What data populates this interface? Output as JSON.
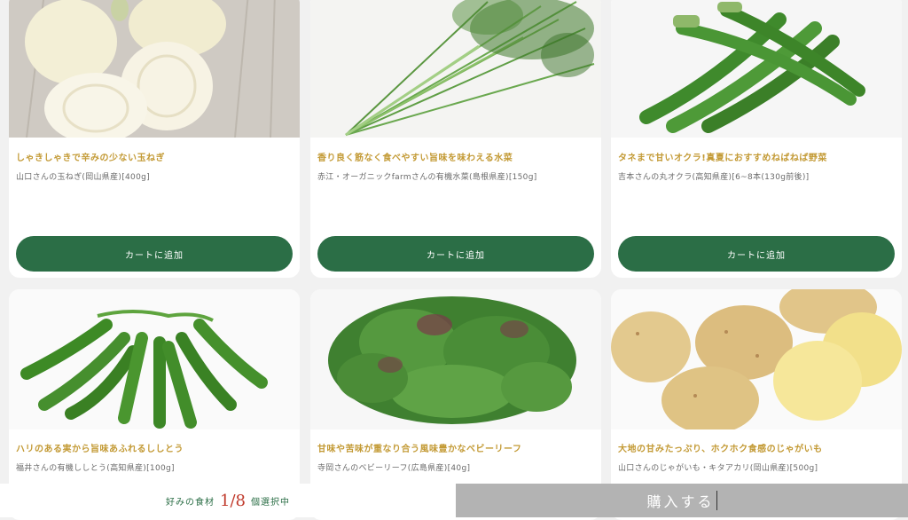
{
  "products": [
    {
      "title": "しゃきしゃきで辛みの少ない玉ねぎ",
      "detail": "山口さんの玉ねぎ(岡山県産)[400g]",
      "button": "カートに追加",
      "image_icon": "onion-image"
    },
    {
      "title": "香り良く筋なく食べやすい旨味を味わえる水菜",
      "detail": "赤江・オーガニックfarmさんの有機水菜(島根県産)[150g]",
      "button": "カートに追加",
      "image_icon": "mizuna-image"
    },
    {
      "title": "タネまで甘いオクラ!真夏におすすめねばねば野菜",
      "detail": "吉本さんの丸オクラ(高知県産)[6~8本(130g前後)]",
      "button": "カートに追加",
      "image_icon": "okra-image"
    },
    {
      "title": "ハリのある実から旨味あふれるししとう",
      "detail": "福井さんの有機ししとう(高知県産)[100g]",
      "image_icon": "shishito-image"
    },
    {
      "title": "甘味や苦味が重なり合う風味豊かなベビーリーフ",
      "detail": "寺岡さんのベビーリーフ(広島県産)[40g]",
      "image_icon": "baby-leaf-image"
    },
    {
      "title": "大地の甘みたっぷり、ホクホク食感のじゃがいも",
      "detail": "山口さんのじゃがいも・キタアカリ(岡山県産)[500g]",
      "image_icon": "potato-image"
    }
  ],
  "footer": {
    "label": "好みの食材",
    "count": "1/8",
    "suffix": "個選択中",
    "buy_button": "購入する"
  },
  "colors": {
    "accent": "#2b6e46",
    "title": "#c39a35",
    "count": "#c0392b",
    "buy_bg": "#b3b3b3"
  }
}
